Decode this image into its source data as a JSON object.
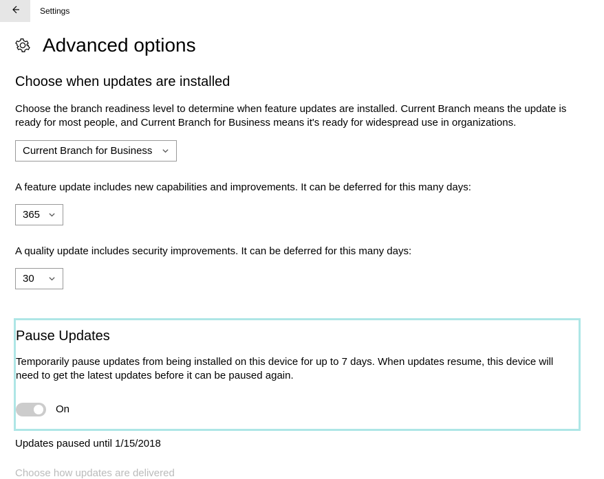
{
  "titlebar": {
    "label": "Settings"
  },
  "header": {
    "title": "Advanced options"
  },
  "section1": {
    "heading": "Choose when updates are installed",
    "description": "Choose the branch readiness level to determine when feature updates are installed. Current Branch means the update is ready for most people, and Current Branch for Business means it's ready for widespread use in organizations.",
    "branch_select": "Current Branch for Business",
    "feature_label": "A feature update includes new capabilities and improvements. It can be deferred for this many days:",
    "feature_days": "365",
    "quality_label": "A quality update includes security improvements. It can be deferred for this many days:",
    "quality_days": "30"
  },
  "pause": {
    "heading": "Pause Updates",
    "description": "Temporarily pause updates from being installed on this device for up to 7 days. When updates resume, this device will need to get the latest updates before it can be paused again.",
    "toggle_label": "On",
    "paused_until": "Updates paused until  1/15/2018"
  },
  "footer": {
    "delivery_link": "Choose how updates are delivered"
  }
}
